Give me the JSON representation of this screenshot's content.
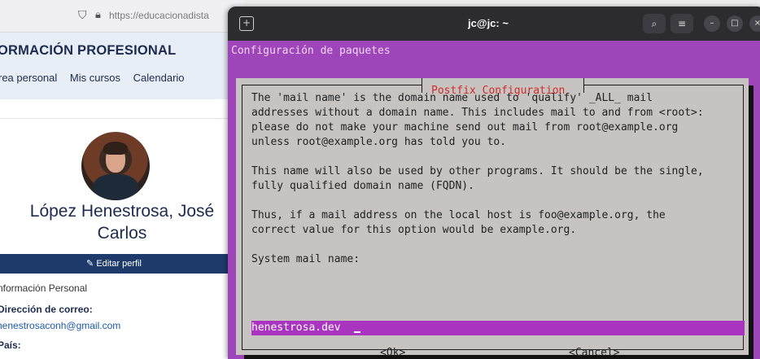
{
  "browser": {
    "url": "https://educacionadista",
    "site_title": "ORMACIÓN PROFESIONAL",
    "nav": [
      "rea personal",
      "Mis cursos",
      "Calendario"
    ],
    "profile": {
      "name_line1": "López Henestrosa, José",
      "name_line2": "Carlos",
      "edit_label": "Editar perfil",
      "section": "nformación Personal",
      "email_label": "Dirección de correo:",
      "email_value": "henestrosaconh@gmail.com",
      "country_label": "País:"
    }
  },
  "terminal": {
    "window_title": "jc@jc: ~",
    "package_config_title": "Configuración de paquetes",
    "dialog": {
      "title": "Postfix Configuration",
      "text": "The 'mail name' is the domain name used to 'qualify' _ALL_ mail\naddresses without a domain name. This includes mail to and from <root>:\nplease do not make your machine send out mail from root@example.org\nunless root@example.org has told you to.\n\nThis name will also be used by other programs. It should be the single,\nfully qualified domain name (FQDN).\n\nThus, if a mail address on the local host is foo@example.org, the\ncorrect value for this option would be example.org.\n\nSystem mail name:",
      "input_value": "henestrosa.dev",
      "ok_label": "<Ok>",
      "cancel_label": "<Cancel>"
    },
    "colors": {
      "background": "#9f45ba",
      "dialog": "#c6c3c0",
      "title_text": "#d32a2a",
      "input_highlight": "#a834bf"
    }
  },
  "icons": {
    "shield": "shield-icon",
    "lock": "lock-icon",
    "new_tab": "new-tab-icon",
    "search": "search-icon",
    "menu": "hamburger-menu-icon",
    "minimize": "minimize-icon",
    "maximize": "maximize-icon",
    "close": "close-icon",
    "edit": "edit-icon"
  }
}
